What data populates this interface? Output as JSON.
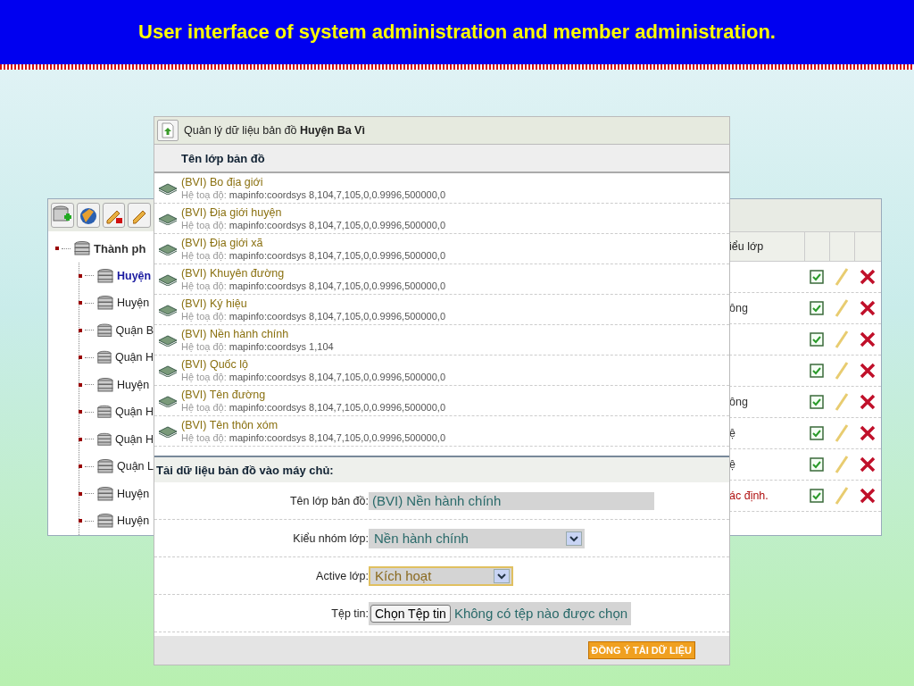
{
  "slide_title": "User interface of system administration and member administration.",
  "back_window": {
    "toolbar": [
      {
        "kind": "add-database"
      },
      {
        "kind": "globe"
      },
      {
        "kind": "edit-red"
      },
      {
        "kind": "edit"
      }
    ],
    "tree": {
      "label": "Thành ph",
      "children": [
        {
          "label": "Huyện",
          "selected": true
        },
        {
          "label": "Huyện",
          "selected": false
        },
        {
          "label": "Quận B",
          "selected": false
        },
        {
          "label": "Quận H",
          "selected": false
        },
        {
          "label": "Huyện",
          "selected": false
        },
        {
          "label": "Quận H",
          "selected": false
        },
        {
          "label": "Quận H",
          "selected": false
        },
        {
          "label": "Quận L",
          "selected": false
        },
        {
          "label": "Huyện",
          "selected": false
        },
        {
          "label": "Huyện",
          "selected": false
        }
      ]
    },
    "table": {
      "column_header": "iểu lớp",
      "rows": [
        {
          "active": true
        },
        {
          "text": "ông",
          "error": false,
          "active": true
        },
        {
          "active": true
        },
        {
          "active": true
        },
        {
          "text": "ông",
          "error": false,
          "active": true
        },
        {
          "text": "ệ",
          "error": false,
          "active": true
        },
        {
          "text": "ệ",
          "error": false,
          "active": true
        },
        {
          "text": "ác định.",
          "error": true,
          "active": true
        }
      ]
    }
  },
  "front_window": {
    "title": "Quản lý dữ liệu bản đồ **Huyện Ba Vì**",
    "column_header": "Tên lớp bản đồ",
    "layers": [
      {
        "name": "(BVI) Bo địa giới",
        "coords_label": "Hệ toạ độ:",
        "coords": "mapinfo:coordsys 8,104,7,105,0,0.9996,500000,0"
      },
      {
        "name": "(BVI) Địa giới huyện",
        "coords_label": "Hệ toạ độ:",
        "coords": "mapinfo:coordsys 8,104,7,105,0,0.9996,500000,0"
      },
      {
        "name": "(BVI) Địa giới xã",
        "coords_label": "Hệ toạ độ:",
        "coords": "mapinfo:coordsys 8,104,7,105,0,0.9996,500000,0"
      },
      {
        "name": "(BVI) Khuyên đường",
        "coords_label": "Hệ toạ độ:",
        "coords": "mapinfo:coordsys 8,104,7,105,0,0.9996,500000,0"
      },
      {
        "name": "(BVI) Ký hiệu",
        "coords_label": "Hệ toạ độ:",
        "coords": "mapinfo:coordsys 8,104,7,105,0,0.9996,500000,0"
      },
      {
        "name": "(BVI) Nền hành chính",
        "coords_label": "Hệ toạ độ:",
        "coords": "mapinfo:coordsys 1,104"
      },
      {
        "name": "(BVI) Quốc lộ",
        "coords_label": "Hệ toạ độ:",
        "coords": "mapinfo:coordsys 8,104,7,105,0,0.9996,500000,0"
      },
      {
        "name": "(BVI) Tên đường",
        "coords_label": "Hệ toạ độ:",
        "coords": "mapinfo:coordsys 8,104,7,105,0,0.9996,500000,0"
      },
      {
        "name": "(BVI) Tên thôn xóm",
        "coords_label": "Hệ toạ độ:",
        "coords": "mapinfo:coordsys 8,104,7,105,0,0.9996,500000,0"
      }
    ],
    "upload": {
      "title": "Tải dữ liệu bản đồ vào máy chủ:",
      "fields": [
        {
          "kind": "text",
          "label": "Tên lớp bản đồ:",
          "value": "(BVI) Nền hành chính"
        },
        {
          "kind": "select",
          "label": "Kiểu nhóm lớp:",
          "value": "Nền hành chính",
          "focused": false
        },
        {
          "kind": "select",
          "label": "Active lớp:",
          "value": "Kích hoạt",
          "focused": true
        },
        {
          "kind": "file",
          "label": "Tệp tin:",
          "button": "Chọn Tệp tin",
          "value": "Không có tệp nào được chọn"
        }
      ],
      "submit": "ĐỒNG Ý TẢI DỮ LIỆU"
    }
  }
}
